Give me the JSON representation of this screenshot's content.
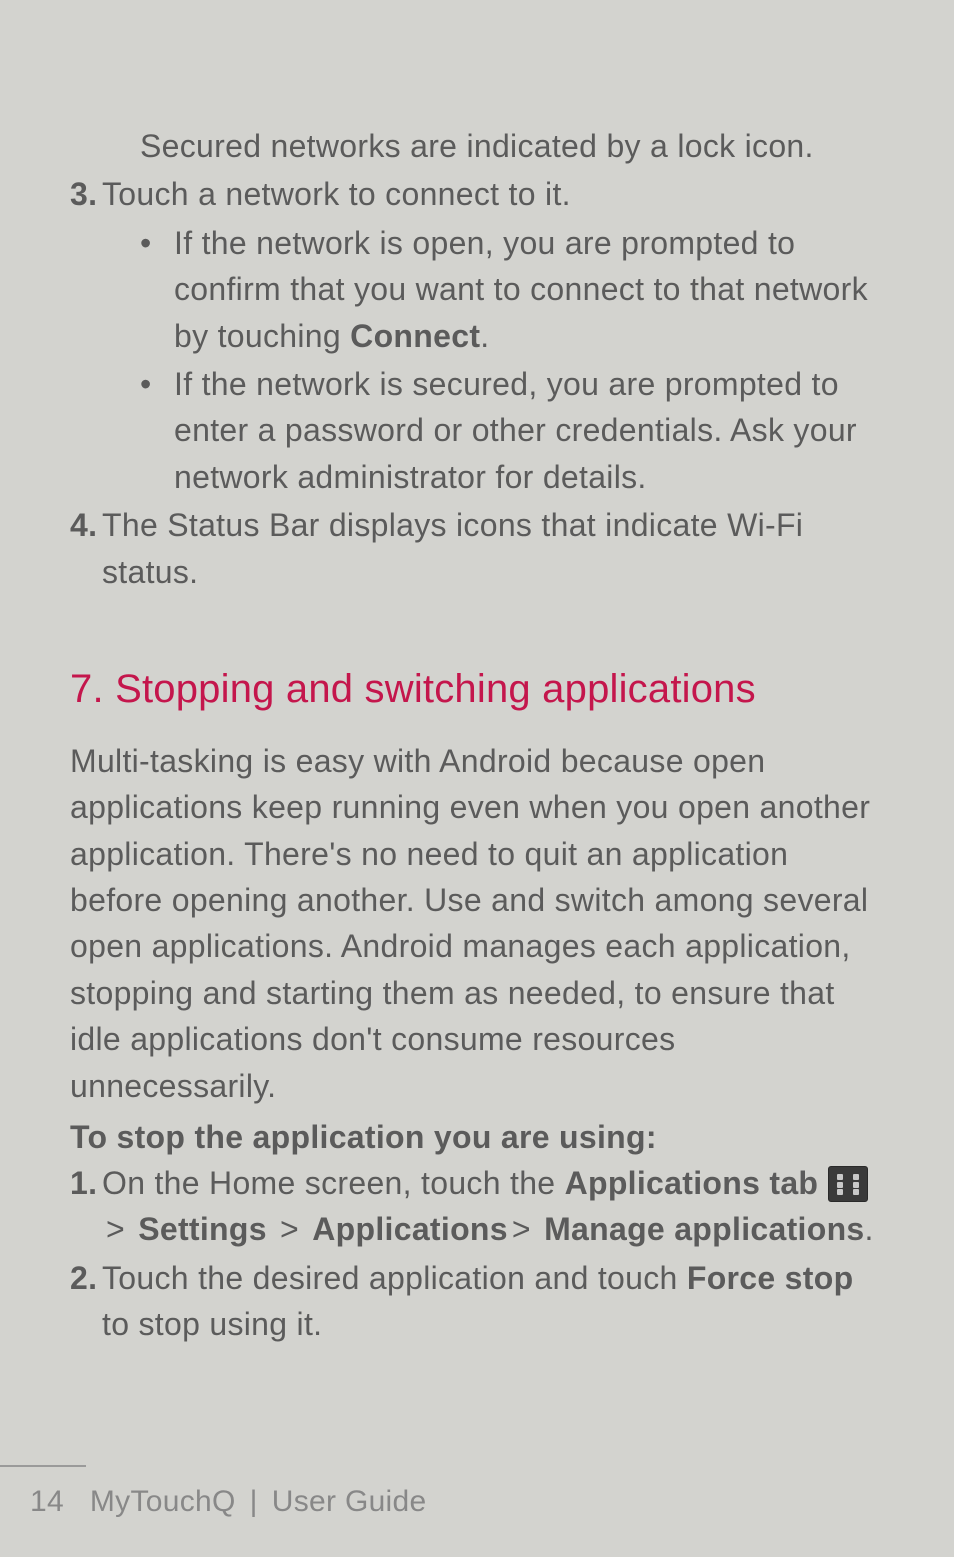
{
  "intro": {
    "secured_networks": "Secured networks are indicated by a lock icon."
  },
  "step3": {
    "num": "3.",
    "text": "Touch a network to connect to it.",
    "bullet1_a": "If the network is open, you are prompted to confirm that you want to connect to that network by touching ",
    "bullet1_bold": "Connect",
    "bullet1_b": ".",
    "bullet2": "If the network is secured, you are prompted to enter a password or other credentials. Ask your network administrator for details."
  },
  "step4": {
    "num": "4.",
    "text": "The Status Bar displays icons that indicate Wi-Fi status."
  },
  "section7": {
    "heading": "7.  Stopping and switching applications",
    "para": "Multi-tasking is easy with Android because open applications keep running even when you open another application. There's no need to quit an application before opening another. Use and switch among several open applications. Android manages each application, stopping and starting them as needed, to ensure that idle applications don't consume resources unnecessarily.",
    "sub_heading": "To stop the application you are using:",
    "s1": {
      "num": "1.",
      "a": "On the Home screen, touch the ",
      "apps_tab_label": "Applications tab",
      "gt1": ">",
      "settings": "Settings",
      "gt2": ">",
      "applications": "Applications",
      "gt3": ">",
      "manage": "Manage applications",
      "dot": "."
    },
    "s2": {
      "num": "2.",
      "a": "Touch the desired application and touch ",
      "force_stop": "Force stop",
      "b": " to stop using it."
    }
  },
  "footer": {
    "page": "14",
    "title": "MyTouchQ",
    "sep": "|",
    "guide": "User Guide"
  }
}
